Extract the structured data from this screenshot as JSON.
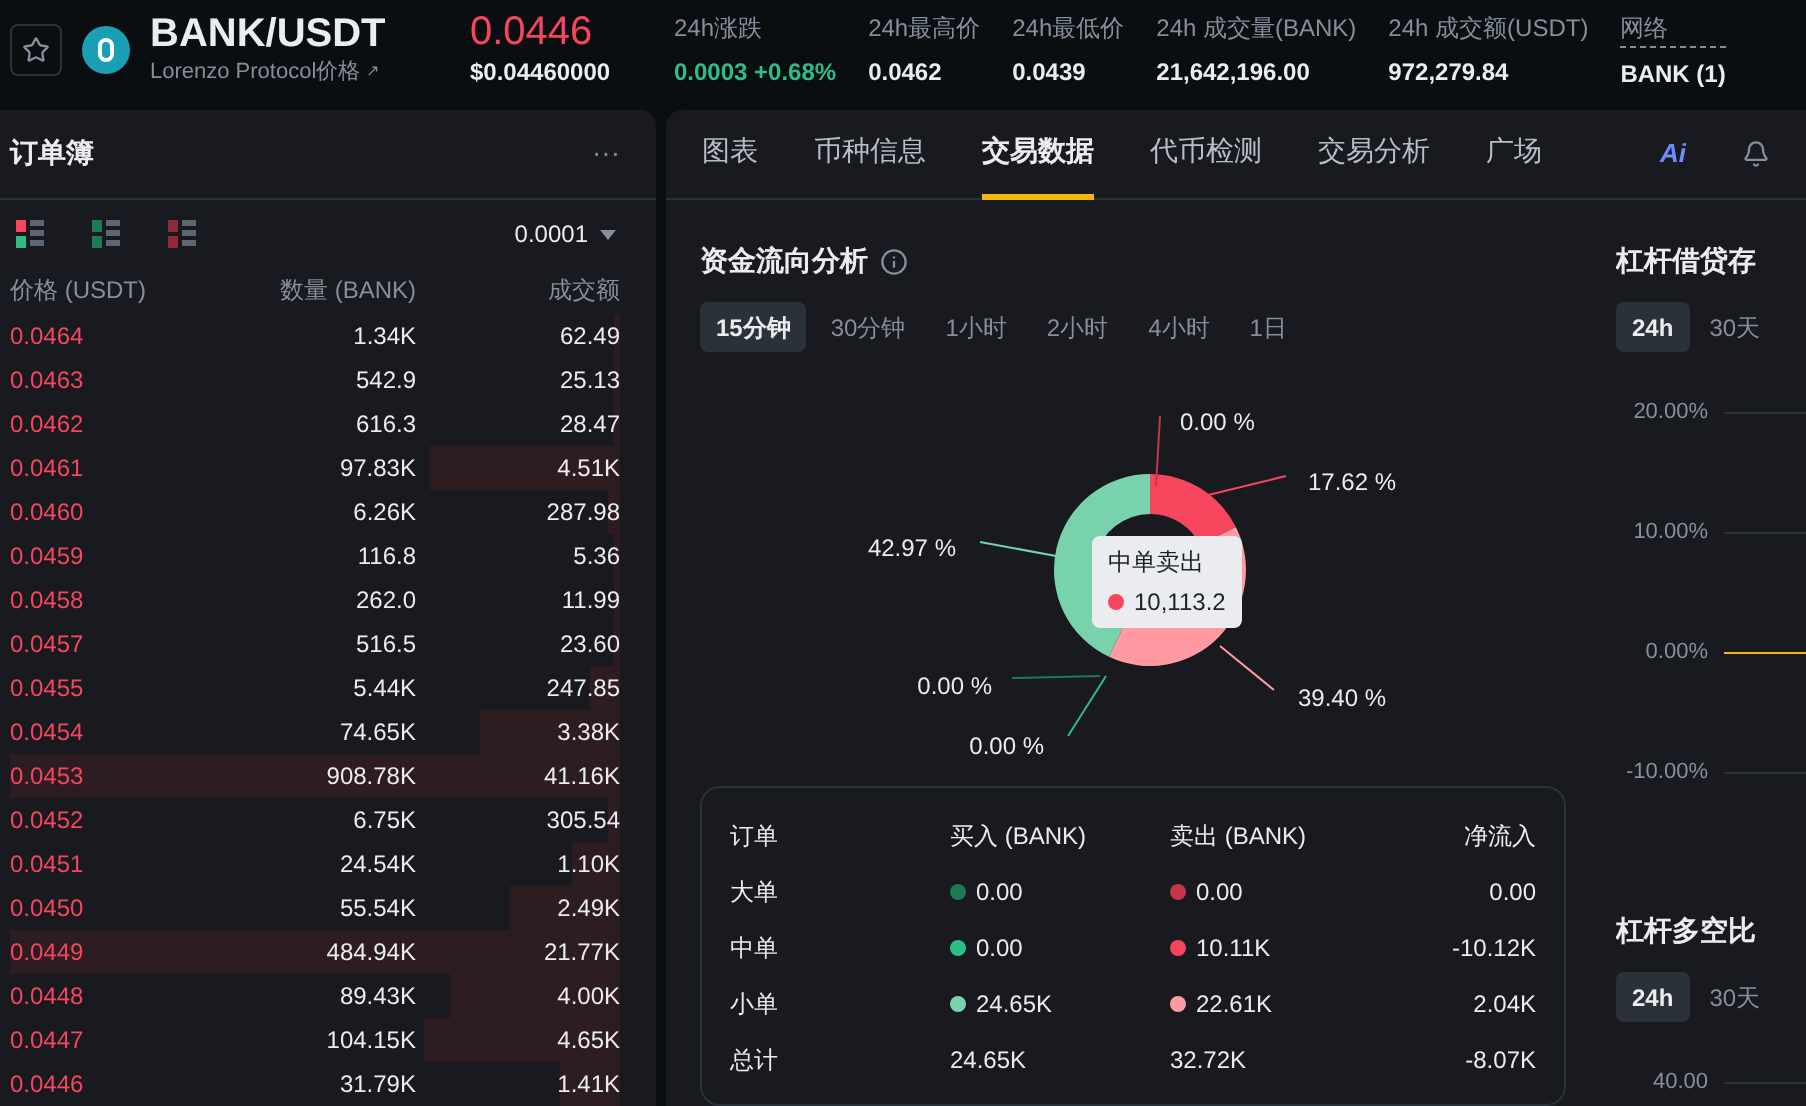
{
  "header": {
    "symbol": "BANK/USDT",
    "subtitle": "Lorenzo Protocol价格",
    "subtitle_icon": "↗",
    "price": "0.0446",
    "price_usd": "$0.04460000",
    "stats": [
      {
        "label": "24h涨跌",
        "value": "0.0003 +0.68%",
        "kind": "change"
      },
      {
        "label": "24h最高价",
        "value": "0.0462",
        "kind": "plain"
      },
      {
        "label": "24h最低价",
        "value": "0.0439",
        "kind": "plain"
      },
      {
        "label": "24h 成交量(BANK)",
        "value": "21,642,196.00",
        "kind": "plain"
      },
      {
        "label": "24h 成交额(USDT)",
        "value": "972,279.84",
        "kind": "plain"
      },
      {
        "label": "网络",
        "value": "BANK (1)",
        "kind": "network"
      }
    ]
  },
  "orderbook": {
    "title": "订单簿",
    "more": "···",
    "views": [
      {
        "kind": "both"
      },
      {
        "kind": "buy"
      },
      {
        "kind": "sell"
      }
    ],
    "precision": "0.0001",
    "columns": [
      "价格 (USDT)",
      "数量 (BANK)",
      "成交额"
    ],
    "rows": [
      {
        "price": "0.0464",
        "amount": "1.34K",
        "total": "62.49",
        "level": 0.01
      },
      {
        "price": "0.0463",
        "amount": "542.9",
        "total": "25.13",
        "level": 0.01
      },
      {
        "price": "0.0462",
        "amount": "616.3",
        "total": "28.47",
        "level": 0.01
      },
      {
        "price": "0.0461",
        "amount": "97.83K",
        "total": "4.51K",
        "level": 0.31
      },
      {
        "price": "0.0460",
        "amount": "6.26K",
        "total": "287.98",
        "level": 0.02
      },
      {
        "price": "0.0459",
        "amount": "116.8",
        "total": "5.36",
        "level": 0.01
      },
      {
        "price": "0.0458",
        "amount": "262.0",
        "total": "11.99",
        "level": 0.01
      },
      {
        "price": "0.0457",
        "amount": "516.5",
        "total": "23.60",
        "level": 0.01
      },
      {
        "price": "0.0455",
        "amount": "5.44K",
        "total": "247.85",
        "level": 0.05
      },
      {
        "price": "0.0454",
        "amount": "74.65K",
        "total": "3.38K",
        "level": 0.23
      },
      {
        "price": "0.0453",
        "amount": "908.78K",
        "total": "41.16K",
        "level": 1.0
      },
      {
        "price": "0.0452",
        "amount": "6.75K",
        "total": "305.54",
        "level": 0.02
      },
      {
        "price": "0.0451",
        "amount": "24.54K",
        "total": "1.10K",
        "level": 0.08
      },
      {
        "price": "0.0450",
        "amount": "55.54K",
        "total": "2.49K",
        "level": 0.18
      },
      {
        "price": "0.0449",
        "amount": "484.94K",
        "total": "21.77K",
        "level": 1.0
      },
      {
        "price": "0.0448",
        "amount": "89.43K",
        "total": "4.00K",
        "level": 0.28
      },
      {
        "price": "0.0447",
        "amount": "104.15K",
        "total": "4.65K",
        "level": 0.32
      },
      {
        "price": "0.0446",
        "amount": "31.79K",
        "total": "1.41K",
        "level": 0.1
      }
    ]
  },
  "tabs": [
    {
      "label": "图表",
      "selected": false
    },
    {
      "label": "币种信息",
      "selected": false
    },
    {
      "label": "交易数据",
      "selected": true
    },
    {
      "label": "代币检测",
      "selected": false
    },
    {
      "label": "交易分析",
      "selected": false
    },
    {
      "label": "广场",
      "selected": false
    }
  ],
  "ai_label": "Ai",
  "fund_flow": {
    "title": "资金流向分析",
    "periods": [
      {
        "label": "15分钟",
        "selected": true
      },
      {
        "label": "30分钟",
        "selected": false
      },
      {
        "label": "1小时",
        "selected": false
      },
      {
        "label": "2小时",
        "selected": false
      },
      {
        "label": "4小时",
        "selected": false
      },
      {
        "label": "1日",
        "selected": false
      }
    ],
    "chart_data": {
      "type": "donut",
      "values": [
        0,
        17.62,
        39.4,
        0,
        0,
        42.97
      ],
      "value_labels": [
        "0.00 %",
        "17.62 %",
        "39.40 %",
        "0.00 %",
        "0.00 %",
        "42.97 %"
      ],
      "colors": [
        "#c7354a",
        "#f6465d",
        "#ff9aa2",
        "#1e7a55",
        "#2ebd85",
        "#78d3ad"
      ]
    },
    "tooltip": {
      "title": "中单卖出",
      "value": "10,113.2",
      "color": "#f6465d"
    },
    "table": {
      "columns": [
        "订单",
        "买入 (BANK)",
        "卖出 (BANK)",
        "净流入"
      ],
      "rows": [
        {
          "label": "大单",
          "buy": {
            "value": "0.00",
            "color": "#1e7a55"
          },
          "sell": {
            "value": "0.00",
            "color": "#c7354a"
          },
          "net": "0.00"
        },
        {
          "label": "中单",
          "buy": {
            "value": "0.00",
            "color": "#2ebd85"
          },
          "sell": {
            "value": "10.11K",
            "color": "#f6465d"
          },
          "net": "-10.12K"
        },
        {
          "label": "小单",
          "buy": {
            "value": "24.65K",
            "color": "#78d3ad"
          },
          "sell": {
            "value": "22.61K",
            "color": "#ff9aa2"
          },
          "net": "2.04K"
        },
        {
          "label": "总计",
          "buy": {
            "value": "24.65K"
          },
          "sell": {
            "value": "32.72K"
          },
          "net": "-8.07K"
        }
      ]
    }
  },
  "margin_lending": {
    "title": "杠杆借贷存",
    "periods": [
      {
        "label": "24h",
        "selected": true
      },
      {
        "label": "30天",
        "selected": false
      }
    ],
    "y_ticks": [
      "20.00%",
      "10.00%",
      "0.00%",
      "-10.00%"
    ]
  },
  "margin_ratio": {
    "title": "杠杆多空比",
    "periods": [
      {
        "label": "24h",
        "selected": true
      },
      {
        "label": "30天",
        "selected": false
      }
    ],
    "y_ticks": [
      "40.00"
    ]
  }
}
